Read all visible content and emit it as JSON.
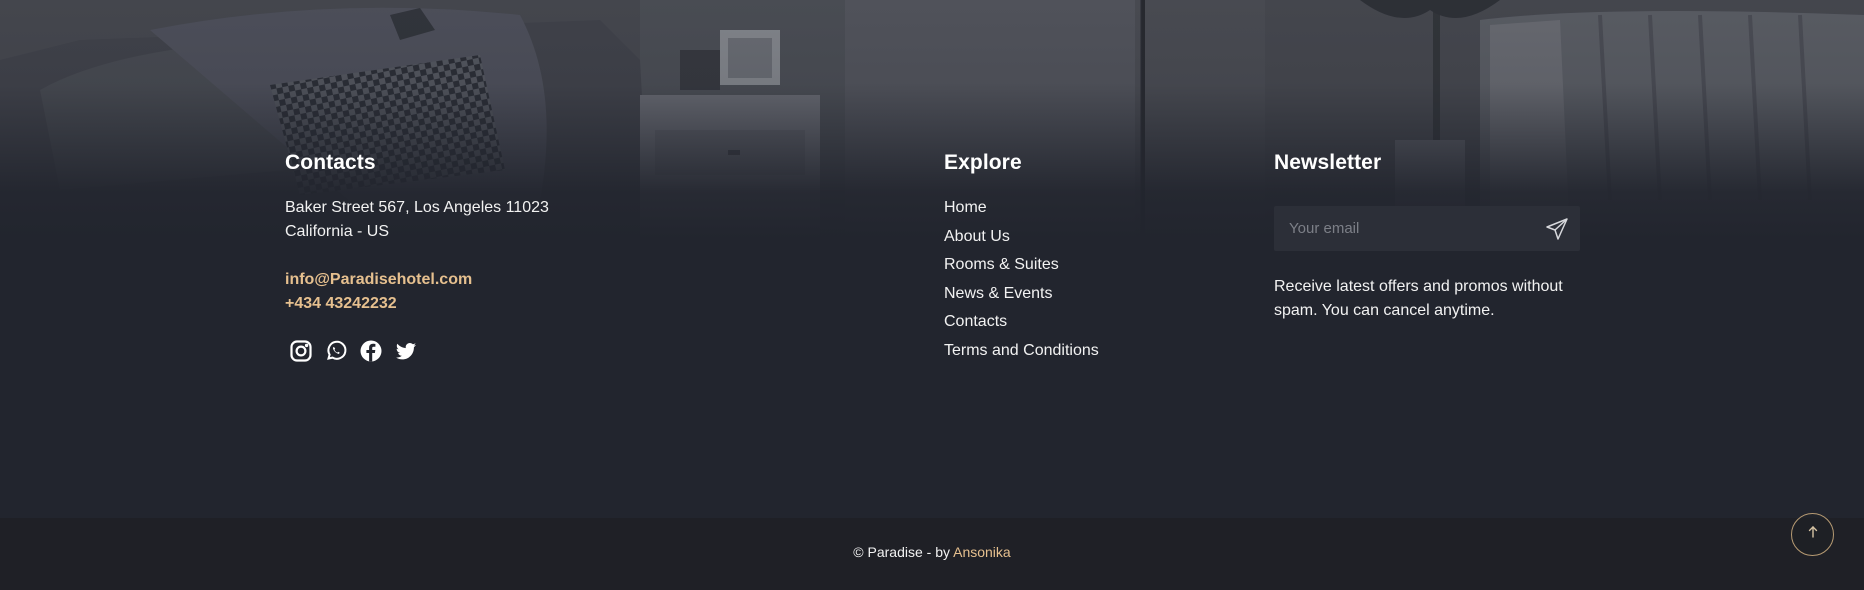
{
  "contacts": {
    "title": "Contacts",
    "address_line1": "Baker Street 567, Los Angeles 11023",
    "address_line2": "California - US",
    "email": "info@Paradisehotel.com",
    "phone": "+434 43242232",
    "socials": [
      "instagram-icon",
      "whatsapp-icon",
      "facebook-icon",
      "twitter-icon"
    ]
  },
  "explore": {
    "title": "Explore",
    "links": [
      "Home",
      "About Us",
      "Rooms & Suites",
      "News & Events",
      "Contacts",
      "Terms and Conditions"
    ]
  },
  "newsletter": {
    "title": "Newsletter",
    "email_placeholder": "Your email",
    "email_value": "",
    "send_icon": "send-icon",
    "description": "Receive latest offers and promos without spam. You can cancel anytime."
  },
  "footer": {
    "copyright_prefix": "© Paradise - by ",
    "author": "Ansonika",
    "back_to_top_icon": "arrow-up-icon"
  },
  "colors": {
    "background": "#22252e",
    "bottom_bar": "#1f2026",
    "accent": "#e6c08f",
    "input_bg": "#2c2f38",
    "back_to_top_border": "#b79b73"
  }
}
